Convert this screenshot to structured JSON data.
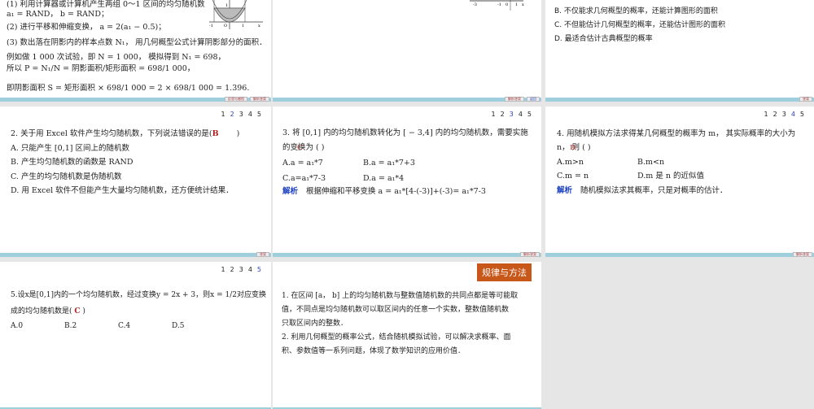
{
  "slides": [
    {
      "lines": [
        "(1) 利用计算器或计算机产生两组 0～1 区间的均匀随机数",
        "a₁ = RAND， b = RAND；",
        "(2) 进行平移和伸缩变换， a = 2(a₁ − 0.5)；",
        "(3) 数出落在阴影内的样本点数 N₁， 用几何概型公式计算阴影部分的面积．",
        "例如做 1 000 次试验，即 N = 1 000， 模拟得到 N₁ = 698，",
        "所以 P = N₁/N = 阴影面积/矩形面积 = 698/1 000，",
        "即阴影面积 S = 矩形面积 × 698/1 000 = 2 × 698/1 000 = 1.396."
      ],
      "graph_labels": [
        "-1",
        "O",
        "1",
        "x",
        "1"
      ],
      "buttons": [
        "反思与感悟",
        "解析答案"
      ]
    },
    {
      "graph_labels": [
        "-3",
        "-1",
        "0",
        "1",
        "x"
      ],
      "buttons": [
        "解析答案",
        "返回"
      ]
    },
    {
      "lines": [
        "B. 不仅能求几何概型的概率，还能计算图形的面积",
        "C. 不但能估计几何概型的概率，还能估计图形的面积",
        "D. 最适合估计古典概型的概率"
      ],
      "buttons": [
        "答案"
      ]
    },
    {
      "pager": [
        "1",
        "2",
        "3",
        "4",
        "5"
      ],
      "question": "2. 关于用 Excel 软件产生均匀随机数，下列说法错误的是(",
      "answer": "B",
      "close": ")",
      "options": [
        "A. 只能产生 [0,1] 区间上的随机数",
        "B. 产生均匀随机数的函数是 RAND",
        "C. 产生的均匀随机数是伪随机数",
        "D. 用 Excel 软件不但能产生大量均匀随机数，还方便统计结果．"
      ],
      "buttons": [
        "答案"
      ]
    },
    {
      "pager": [
        "1",
        "2",
        "3",
        "4",
        "5"
      ],
      "question": [
        "3. 将 [0,1] 内的均匀随机数转化为 [ − 3,4] 内的均匀随机数，需要实施",
        "的变换为 (        )"
      ],
      "answer": "C",
      "options": [
        "A.a = a₁*7",
        "B.a = a₁*7+3",
        "C.a=a₁*7-3",
        "D.a = a₁*4"
      ],
      "analysis_label": "解析",
      "analysis": "根据伸缩和平移变换 a = a₁*[4-(-3)]+(-3)= a₁*7-3",
      "buttons": [
        "解析答案"
      ]
    },
    {
      "pager": [
        "1",
        "2",
        "3",
        "4",
        "5"
      ],
      "question": [
        "4. 用随机模拟方法求得某几何概型的概率为 m， 其实际概率的大小为",
        "n， 则 (        )"
      ],
      "answer": "D",
      "options": [
        "A.m>n",
        "B.m<n",
        "C.m = n",
        "D.m 是 n 的近似值"
      ],
      "analysis_label": "解析",
      "analysis": "随机模拟法求其概率，只是对概率的估计．",
      "buttons": [
        "解析答案"
      ]
    },
    {
      "pager": [
        "1",
        "2",
        "3",
        "4",
        "5"
      ],
      "question": [
        "5.设x是[0,1]内的一个均匀随机数，经过变换y = 2x + 3，则x = 1/2对应变换",
        "成的均匀随机数是(  "
      ],
      "answer": "C",
      "close": " )",
      "options": [
        "A.0",
        "B.2",
        "C.4",
        "D.5"
      ]
    },
    {
      "badge": "规律与方法",
      "lines": [
        "1. 在区间 [a， b] 上的均匀随机数与整数值随机数的共同点都是等可能取",
        "值，不同点是均匀随机数可以取区间内的任意一个实数，整数值随机数",
        "只取区间内的整数．",
        "2. 利用几何概型的概率公式，结合随机模拟试验，可以解决求概率、面",
        "积、参数值等一系列问题，体现了数学知识的应用价值．"
      ]
    }
  ],
  "colors": {
    "bar": "#9fcfdc",
    "badge": "#c8581a",
    "answer": "#b02020",
    "analysis": "#1a3fc0"
  }
}
